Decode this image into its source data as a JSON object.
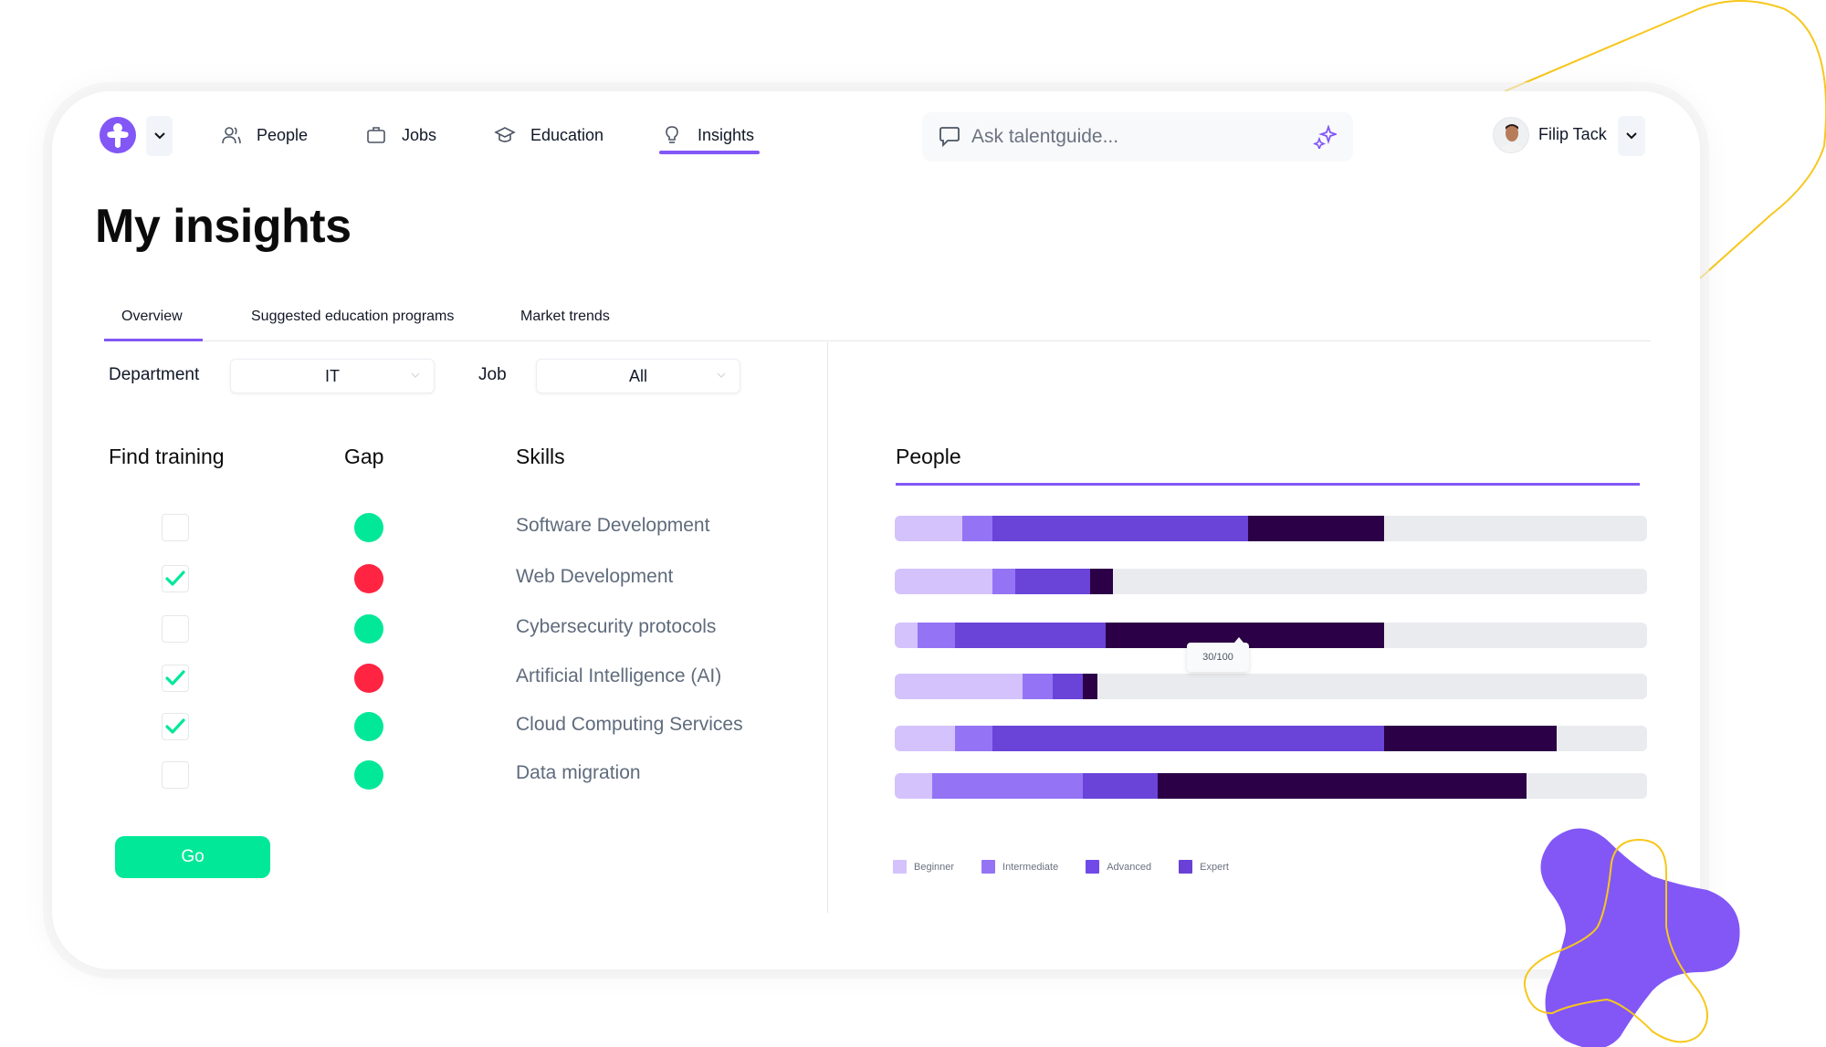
{
  "nav": {
    "items": [
      {
        "label": "People",
        "icon": "people-icon"
      },
      {
        "label": "Jobs",
        "icon": "briefcase-icon"
      },
      {
        "label": "Education",
        "icon": "graduation-cap-icon"
      },
      {
        "label": "Insights",
        "icon": "lightbulb-icon",
        "active": true
      }
    ]
  },
  "search": {
    "placeholder": "Ask talentguide...",
    "value": ""
  },
  "user": {
    "name": "Filip Tack"
  },
  "page": {
    "title": "My insights"
  },
  "tabs": [
    {
      "label": "Overview",
      "active": true
    },
    {
      "label": "Suggested education programs"
    },
    {
      "label": "Market trends"
    }
  ],
  "filters": {
    "department": {
      "label": "Department",
      "value": "IT"
    },
    "job": {
      "label": "Job",
      "value": "All"
    }
  },
  "columns": {
    "find_training": "Find training",
    "gap": "Gap",
    "skills": "Skills",
    "people": "People"
  },
  "rows": [
    {
      "skill": "Software Development",
      "checked": false,
      "gap": "ok"
    },
    {
      "skill": "Web Development",
      "checked": true,
      "gap": "gap"
    },
    {
      "skill": "Cybersecurity protocols",
      "checked": false,
      "gap": "ok"
    },
    {
      "skill": "Artificial Intelligence (AI)",
      "checked": true,
      "gap": "gap"
    },
    {
      "skill": "Cloud Computing Services",
      "checked": true,
      "gap": "ok"
    },
    {
      "skill": "Data migration",
      "checked": false,
      "gap": "ok"
    }
  ],
  "go_button": "Go",
  "colors": {
    "accent": "#8257f6",
    "gap_ok": "#02e899",
    "gap_missing": "#ff2442",
    "check": "#02e899",
    "track": "#eaebef"
  },
  "chart_data": {
    "type": "bar",
    "orientation": "horizontal-stacked",
    "title": "People",
    "categories": [
      "Software Development",
      "Web Development",
      "Cybersecurity protocols",
      "Artificial Intelligence (AI)",
      "Cloud Computing Services",
      "Data migration"
    ],
    "xlim": [
      0,
      100
    ],
    "series": [
      {
        "name": "Beginner",
        "color": "#d4c2fd",
        "values": [
          9,
          13,
          3,
          17,
          8,
          5
        ]
      },
      {
        "name": "Intermediate",
        "color": "#9474f5",
        "values": [
          4,
          3,
          5,
          4,
          5,
          20
        ]
      },
      {
        "name": "Advanced",
        "color": "#6a43d8",
        "values": [
          34,
          10,
          20,
          4,
          52,
          10
        ]
      },
      {
        "name": "Expert",
        "color": "#2c0046",
        "values": [
          18,
          3,
          37,
          2,
          23,
          49
        ]
      }
    ],
    "legend": [
      {
        "name": "Beginner",
        "color": "#d4c2fd"
      },
      {
        "name": "Intermediate",
        "color": "#9474f5"
      },
      {
        "name": "Advanced",
        "color": "#6f4ae8"
      },
      {
        "name": "Expert",
        "color": "#6941d6"
      }
    ],
    "legend_position": "bottom-left",
    "tooltip": {
      "row": 2,
      "text": "30/100"
    }
  }
}
